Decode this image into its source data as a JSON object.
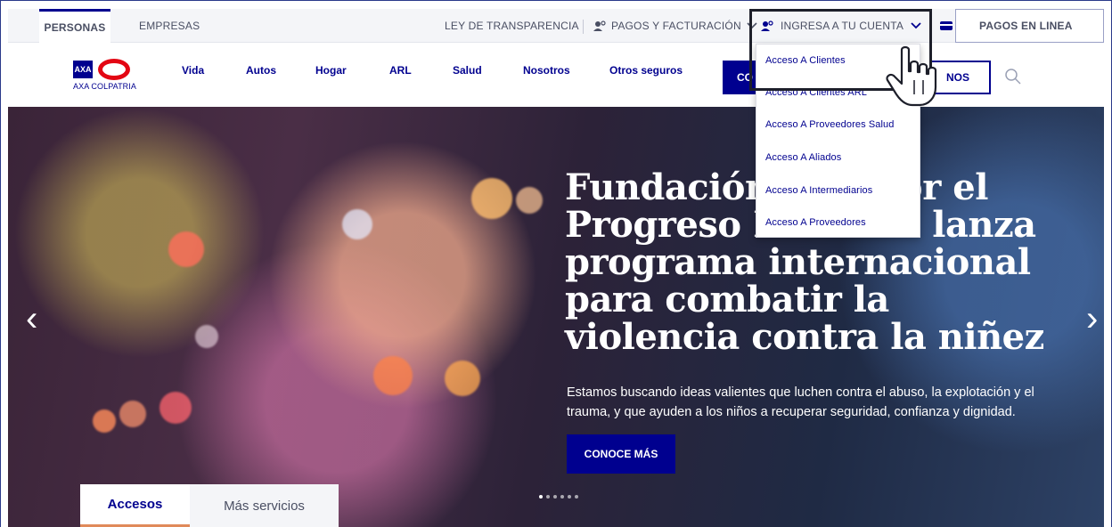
{
  "topbar": {
    "tab_personas": "PERSONAS",
    "tab_empresas": "EMPRESAS",
    "ley_transparencia": "LEY DE TRANSPARENCIA",
    "pagos_facturacion": "PAGOS Y FACTURACIÓN",
    "ingresa_cuenta": "INGRESA A TU CUENTA",
    "pagos_linea": "PAGOS EN LINEA"
  },
  "navbar": {
    "logo_text": "AXA COLPATRIA",
    "links": [
      "Vida",
      "Autos",
      "Hogar",
      "ARL",
      "Salud",
      "Nosotros",
      "Otros seguros"
    ],
    "cotiza_partial": "CO",
    "contact_partial": "NOS"
  },
  "dropdown": {
    "items": [
      "Acceso A Clientes",
      "Acceso A Clientes ARL",
      "Acceso A Proveedores Salud",
      "Acceso A Aliados",
      "Acceso A Intermediarios",
      "Acceso A Proveedores"
    ]
  },
  "hero": {
    "title": "Fundación AXA por el Progreso Humano lanza programa internacional para combatir la violencia contra la niñez",
    "text": "Estamos buscando ideas valientes que luchen contra el abuso, la explotación y el trauma, y que ayuden a los niños a recuperar seguridad, confianza y dignidad.",
    "button": "CONOCE MÁS",
    "prev_arrow": "‹",
    "next_arrow": "›"
  },
  "tabs": {
    "accesos": "Accesos",
    "mas_servicios": "Más servicios"
  },
  "colors": {
    "brand_blue": "#00008f",
    "brand_red": "#e30613",
    "accent_orange": "#e08a5a"
  }
}
